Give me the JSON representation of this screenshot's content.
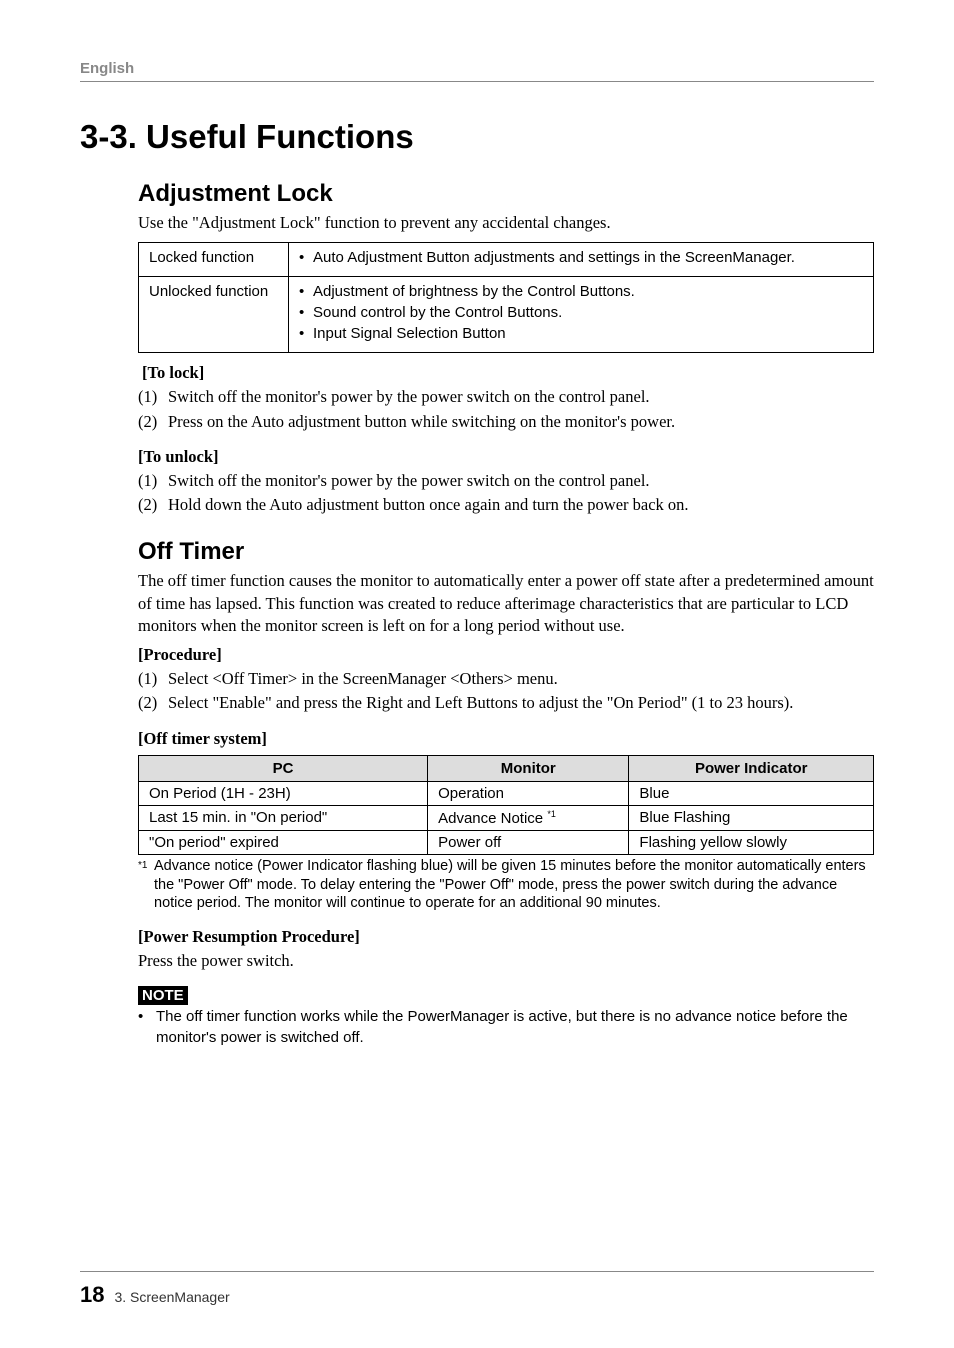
{
  "header": {
    "lang": "English"
  },
  "title": "3-3. Useful Functions",
  "adj": {
    "heading": "Adjustment Lock",
    "lead": "Use the \"Adjustment Lock\" function to prevent any accidental changes.",
    "locked_label": "Locked function",
    "locked_item": "Auto Adjustment Button adjustments and settings in the ScreenManager.",
    "unlocked_label": "Unlocked function",
    "unlocked_items": [
      "Adjustment of brightness by the Control Buttons.",
      "Sound control by the Control Buttons.",
      "Input Signal Selection Button"
    ],
    "to_lock": "[To lock]",
    "lock_steps": [
      "Switch off the monitor's power by the power switch on the control panel.",
      "Press on the Auto adjustment button while switching on the monitor's power."
    ],
    "to_unlock": "[To unlock]",
    "unlock_steps": [
      "Switch off the monitor's power by the power switch on the control panel.",
      "Hold down the Auto adjustment button once again and turn the power back on."
    ]
  },
  "off": {
    "heading": "Off Timer",
    "lead": "The off timer function causes the monitor to automatically enter a power off state after a predetermined amount of time has lapsed. This function was created to reduce afterimage characteristics that are particular to LCD monitors when the monitor screen is left on for a long period without use.",
    "procedure_label": "[Procedure]",
    "proc_steps": [
      "Select <Off Timer> in the ScreenManager <Others> menu.",
      "Select \"Enable\" and press the Right and Left Buttons to adjust the \"On Period\" (1 to 23 hours)."
    ],
    "system_label": "[Off timer system]",
    "table": {
      "h1": "PC",
      "h2": "Monitor",
      "h3": "Power Indicator",
      "r1c1": "On Period (1H - 23H)",
      "r1c2": "Operation",
      "r1c3": "Blue",
      "r2c1": "Last 15 min. in \"On period\"",
      "r2c2": "Advance Notice ",
      "r2sup": "*1",
      "r2c3": "Blue Flashing",
      "r3c1": "\"On period\" expired",
      "r3c2": "Power off",
      "r3c3": "Flashing yellow slowly"
    },
    "footnote_mark": "*1",
    "footnote": "Advance notice (Power Indicator flashing blue) will be given 15 minutes before the monitor automatically enters the \"Power Off\" mode. To delay entering the \"Power Off\" mode, press the power switch during the advance notice period. The monitor will continue to operate for an additional 90 minutes.",
    "resume_label": "[Power Resumption Procedure]",
    "resume_text": "Press the power switch.",
    "note_label": "NOTE",
    "note_text": "The off timer function works while the PowerManager is active, but there is no advance notice before the monitor's power is switched off."
  },
  "footer": {
    "page": "18",
    "chapter": "3. ScreenManager"
  }
}
